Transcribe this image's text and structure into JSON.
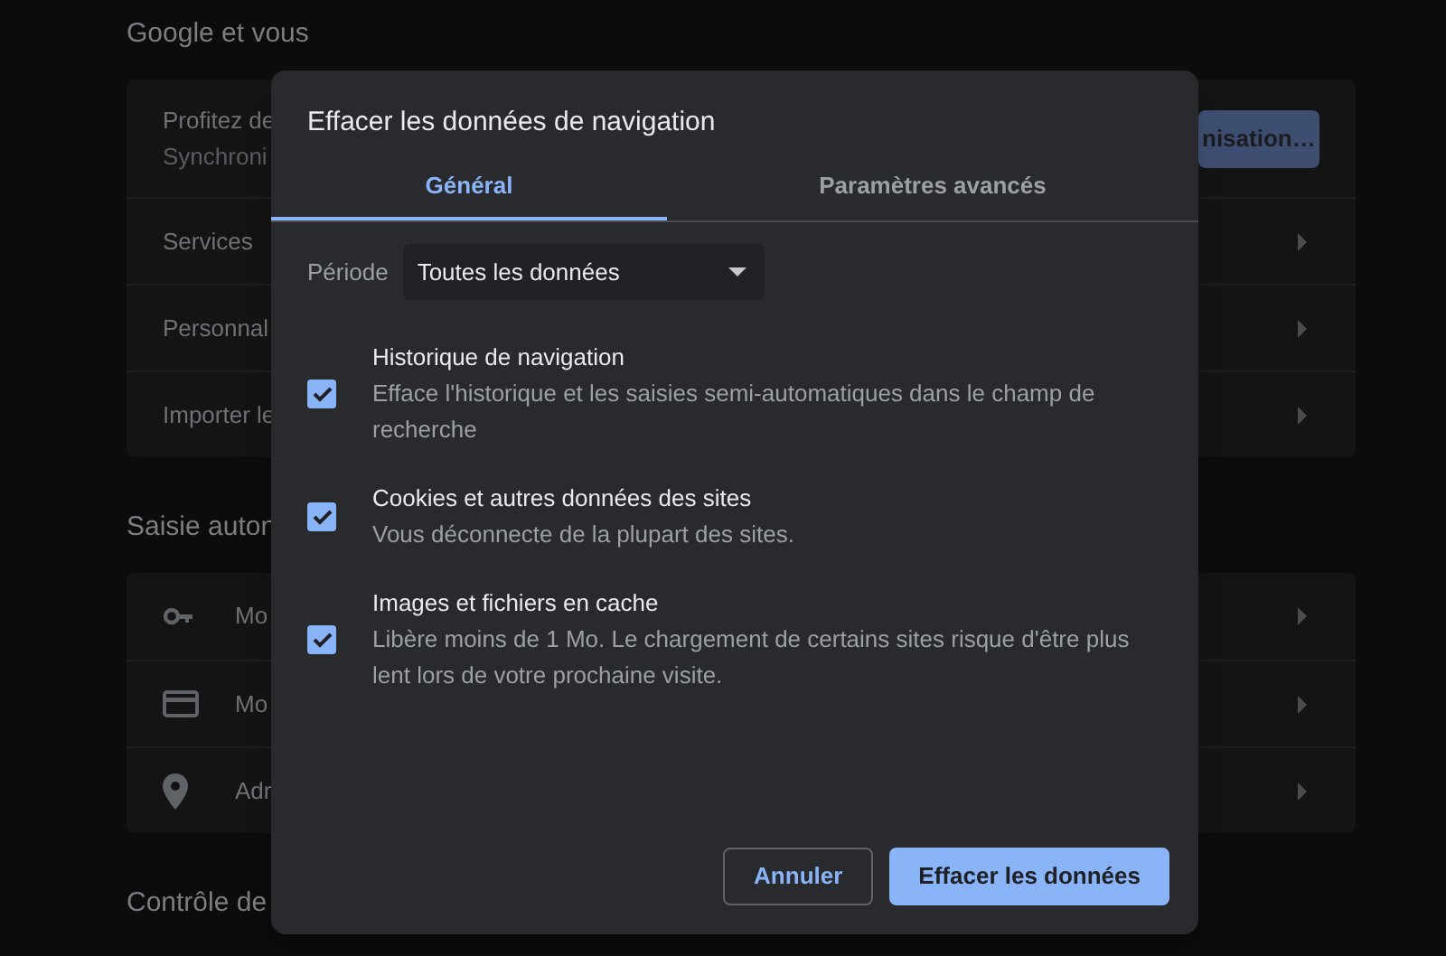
{
  "settings": {
    "sections": [
      {
        "title": "Google et vous",
        "rows": [
          {
            "kind": "profile",
            "text": "Profitez de",
            "subtext": "Synchroni",
            "button": "nisation…"
          },
          {
            "kind": "link",
            "text": "Services"
          },
          {
            "kind": "link",
            "text": "Personnal"
          },
          {
            "kind": "link",
            "text": "Importer le"
          }
        ]
      },
      {
        "title": "Saisie auton",
        "rows": [
          {
            "kind": "icon-link",
            "text": "Mo"
          },
          {
            "kind": "icon-link",
            "text": "Mo"
          },
          {
            "kind": "icon-link",
            "text": "Adr"
          }
        ]
      },
      {
        "title": "Contrôle de"
      }
    ]
  },
  "dialog": {
    "title": "Effacer les données de navigation",
    "tabs": [
      {
        "label": "Général",
        "selected": true
      },
      {
        "label": "Paramètres avancés",
        "selected": false
      }
    ],
    "period": {
      "label": "Période",
      "value": "Toutes les données"
    },
    "options": [
      {
        "title": "Historique de navigation",
        "description": "Efface l'historique et les saisies semi-automatiques dans le champ de recherche",
        "checked": true
      },
      {
        "title": "Cookies et autres données des sites",
        "description": "Vous déconnecte de la plupart des sites.",
        "checked": true
      },
      {
        "title": "Images et fichiers en cache",
        "description": "Libère moins de 1 Mo. Le chargement de certains sites risque d'être plus lent lors de votre prochaine visite.",
        "checked": true
      }
    ],
    "buttons": [
      {
        "label": "Annuler",
        "kind": "secondary"
      },
      {
        "label": "Effacer les données",
        "kind": "primary"
      }
    ]
  }
}
